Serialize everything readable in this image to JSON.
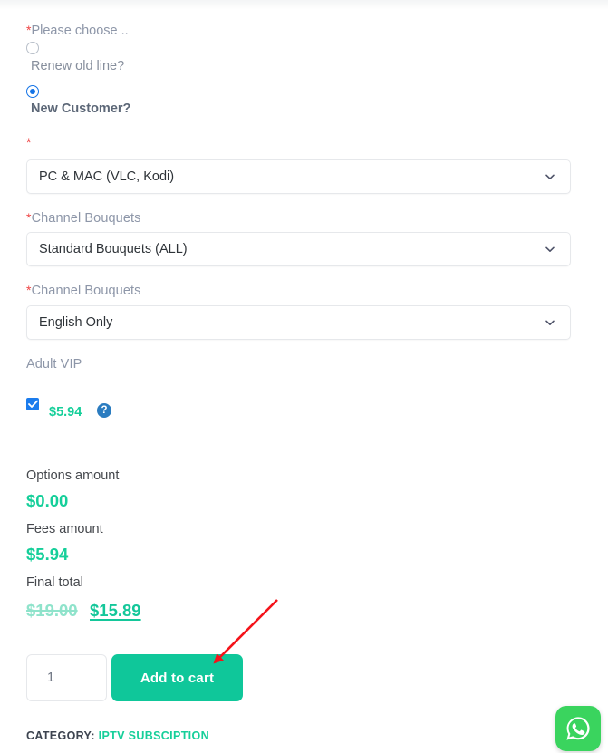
{
  "form": {
    "choose_label": "Please choose ..",
    "required_marker": "*",
    "options": [
      {
        "label": "Renew old line?",
        "selected": false
      },
      {
        "label": "New Customer?",
        "selected": true
      }
    ]
  },
  "selects": [
    {
      "label": "",
      "value": "PC & MAC (VLC, Kodi)",
      "required": true
    },
    {
      "label": "Channel Bouquets",
      "value": "Standard Bouquets (ALL)",
      "required": true
    },
    {
      "label": "Channel Bouquets",
      "value": "English Only",
      "required": true
    }
  ],
  "addon": {
    "label": "Adult VIP",
    "checked": true,
    "price": "$5.94",
    "help_icon": "question-mark-icon"
  },
  "totals": [
    {
      "label": "Options amount",
      "value": "$0.00"
    },
    {
      "label": "Fees amount",
      "value": "$5.94"
    }
  ],
  "final_total": {
    "label": "Final total",
    "old_price": "$19.00",
    "new_price": "$15.89"
  },
  "cart": {
    "quantity_value": "1",
    "quantity_placeholder": "1",
    "add_to_cart_label": "Add to cart"
  },
  "category": {
    "key": "CATEGORY:",
    "value": "IPTV SUBSCIPTION"
  },
  "widgets": {
    "whatsapp_label": "whatsapp-icon"
  },
  "colors": {
    "accent_green": "#0fc79a",
    "price_green": "#16cf9a",
    "old_price_green": "#8fe3cb",
    "radio_blue": "#1473e6",
    "checkbox_blue": "#1b7ced",
    "help_blue": "#2b7cc0",
    "required_red": "#ef4444",
    "label_gray": "#8d96a8",
    "whatsapp_green": "#3ad45e",
    "annotation_red": "#f4131a"
  }
}
